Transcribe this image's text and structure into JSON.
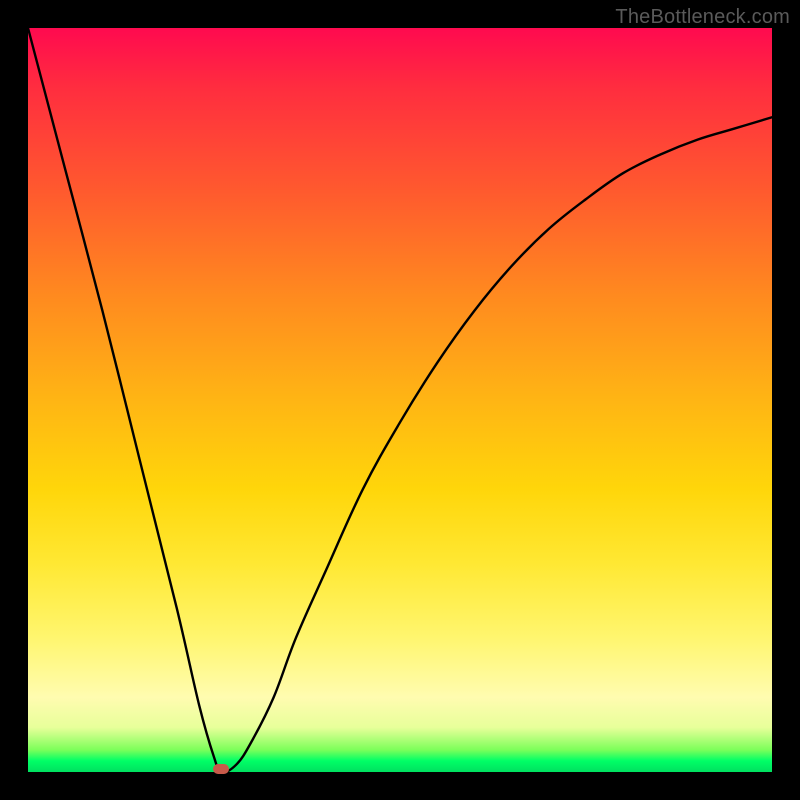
{
  "watermark": "TheBottleneck.com",
  "chart_data": {
    "type": "line",
    "title": "",
    "xlabel": "",
    "ylabel": "",
    "xlim": [
      0,
      100
    ],
    "ylim": [
      0,
      100
    ],
    "grid": false,
    "legend": false,
    "series": [
      {
        "name": "bottleneck-curve",
        "x": [
          0,
          5,
          10,
          15,
          20,
          23,
          25,
          26,
          28,
          30,
          33,
          36,
          40,
          45,
          50,
          55,
          60,
          65,
          70,
          75,
          80,
          85,
          90,
          95,
          100
        ],
        "y": [
          100,
          81,
          62,
          42,
          22,
          9,
          2,
          0,
          1,
          4,
          10,
          18,
          27,
          38,
          47,
          55,
          62,
          68,
          73,
          77,
          80.5,
          83,
          85,
          86.5,
          88
        ]
      }
    ],
    "annotations": [
      {
        "name": "minimum-marker",
        "x": 26,
        "y": 0,
        "shape": "pill",
        "color": "#c85a4a"
      }
    ],
    "background_gradient": {
      "direction": "vertical",
      "stops": [
        {
          "pos": 0.0,
          "color": "#ff0a4f"
        },
        {
          "pos": 0.22,
          "color": "#ff5a2e"
        },
        {
          "pos": 0.5,
          "color": "#ffb514"
        },
        {
          "pos": 0.72,
          "color": "#ffe833"
        },
        {
          "pos": 0.9,
          "color": "#fffcb0"
        },
        {
          "pos": 0.97,
          "color": "#7dff5a"
        },
        {
          "pos": 1.0,
          "color": "#00e060"
        }
      ]
    }
  }
}
